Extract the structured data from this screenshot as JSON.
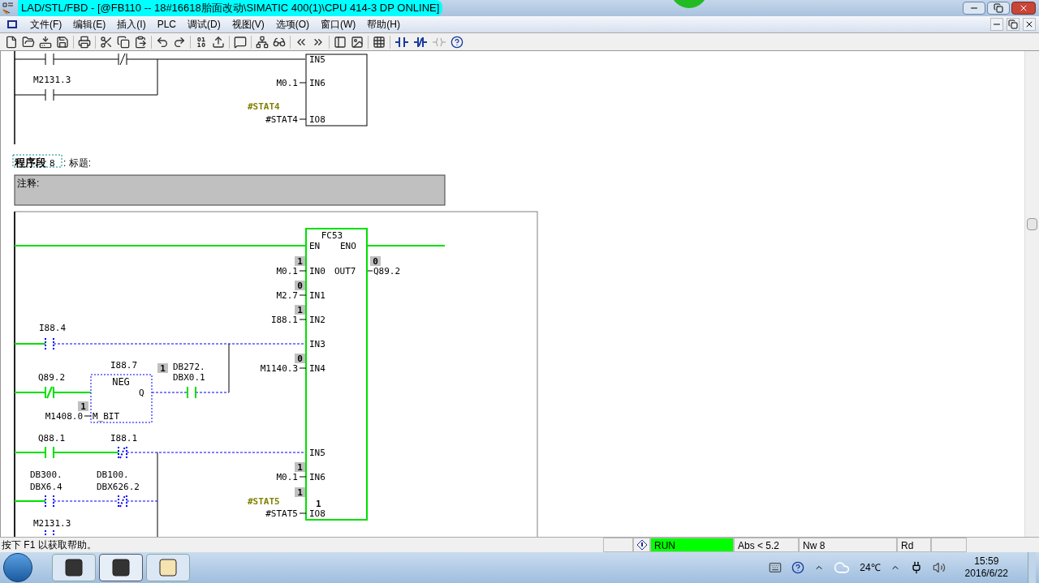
{
  "window": {
    "title": "LAD/STL/FBD  - [@FB110 -- 18#16618胎面改动\\SIMATIC 400(1)\\CPU 414-3 DP  ONLINE]"
  },
  "menu": [
    "文件(F)",
    "编辑(E)",
    "插入(I)",
    "PLC",
    "调试(D)",
    "视图(V)",
    "选项(O)",
    "窗口(W)",
    "帮助(H)"
  ],
  "prev_network": {
    "contacts": [
      {
        "kind": "no"
      },
      {
        "kind": "nc"
      },
      {
        "kind": "no",
        "label": [
          "M2131.3"
        ]
      }
    ],
    "pins": [
      {
        "pin": "IN5"
      },
      {
        "pin": "IN6",
        "operand": "M0.1"
      },
      {
        "pin": "IO8",
        "operand": "#STAT4",
        "symbol": "#STAT4"
      }
    ]
  },
  "network": {
    "title": "程序段",
    "number": "8",
    "title_label": ": 标题:",
    "comment": "注释:",
    "block": {
      "name": "FC53",
      "en": "EN",
      "eno": "ENO",
      "powered": true,
      "inputs": [
        {
          "pin": "IN0",
          "operand": "M0.1",
          "status": "1"
        },
        {
          "pin": "IN1",
          "operand": "M2.7",
          "status": "0"
        },
        {
          "pin": "IN2",
          "operand": "I88.1",
          "status": "1"
        },
        {
          "pin": "IN3"
        },
        {
          "pin": "IN4",
          "operand": "M1140.3",
          "status": "0"
        },
        {
          "pin": "IN5"
        },
        {
          "pin": "IN6",
          "operand": "M0.1",
          "status": "1"
        },
        {
          "pin": "IO8",
          "operand": "#STAT5",
          "symbol": "#STAT5",
          "status": "1",
          "inner_status": "1"
        }
      ],
      "output": {
        "pin": "OUT7",
        "operand": "Q89.2",
        "status": "0"
      }
    },
    "contacts": [
      {
        "kind": "no",
        "label": [
          "I88.4"
        ],
        "closed": false
      },
      {
        "kind": "nc",
        "label": [
          "Q89.2"
        ],
        "closed": true
      },
      {
        "kind": "no",
        "label": [
          "DB272.",
          "DBX0.1"
        ],
        "closed": true
      },
      {
        "kind": "no",
        "label": [
          "Q88.1"
        ],
        "closed": true
      },
      {
        "kind": "nc",
        "label": [
          "I88.1"
        ],
        "closed": false
      },
      {
        "kind": "no",
        "label": [
          "DB300.",
          "DBX6.4"
        ],
        "closed": false
      },
      {
        "kind": "nc",
        "label": [
          "DB100.",
          "DBX626.2"
        ],
        "closed": false
      },
      {
        "kind": "no",
        "label": [
          "M2131.3"
        ],
        "closed": false
      }
    ],
    "neg": {
      "name": "NEG",
      "address": "I88.7",
      "output": "Q",
      "input_pin": "M_BIT",
      "input_operand": "M1408.0",
      "input_status": "1",
      "output_status": "1",
      "closed": false
    }
  },
  "status_bar": {
    "help": "按下 F1 以获取帮助。",
    "mode": "RUN",
    "running": true,
    "address": "Abs < 5.2",
    "network": "Nw 8",
    "access": "Rd"
  },
  "taskbar": {
    "temperature": "24℃",
    "time": "15:59",
    "date": "2016/6/22"
  }
}
